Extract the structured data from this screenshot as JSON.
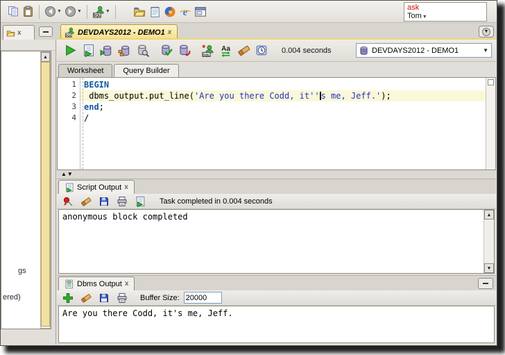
{
  "colors": {
    "active_tab": "#f6df85",
    "line_highlight": "#faf8d8",
    "keyword": "#10599c",
    "string": "#2233cc",
    "plain": "#000000",
    "search_accent": "#cc1100",
    "left_scroll_thumb": "#f2e2a2"
  },
  "top_toolbar": {
    "icons": [
      "copy-icon",
      "paste-icon",
      "back-icon",
      "forward-icon",
      "sql-worksheet-icon",
      "open-folder-icon",
      "notepad-icon",
      "firefox-icon",
      "internet-explorer-icon",
      "form-window-icon"
    ]
  },
  "search_box": {
    "line1": "ask",
    "line2": "Tom"
  },
  "tab_bar": {
    "main_tab_label": "DEVDAYS2012 - DEMO1",
    "left_tab_close": "x",
    "main_tab_close": "x"
  },
  "worksheet_toolbar": {
    "icons": [
      "run-icon",
      "run-script-icon",
      "autotrace-icon",
      "explain-plan-icon",
      "sql-tuning-advisor-icon",
      "commit-icon",
      "rollback-icon",
      "unshared-worksheet-icon",
      "case-toggle-icon",
      "clear-icon",
      "sql-history-icon"
    ],
    "elapsed_text": "0.004 seconds",
    "connection_label": "DEVDAYS2012 - DEMO1"
  },
  "editor_tabs": {
    "worksheet": "Worksheet",
    "query_builder": "Query Builder"
  },
  "editor": {
    "line_numbers": [
      "1",
      "2",
      "3",
      "4"
    ],
    "lines": [
      {
        "highlight": false,
        "segments": [
          {
            "text": "BEGIN",
            "type": "keyword"
          }
        ]
      },
      {
        "highlight": true,
        "segments": [
          {
            "text": " dbms_output.put_line(",
            "type": "plain"
          },
          {
            "text": "'Are you there Codd, it''",
            "type": "string"
          },
          {
            "text": "",
            "type": "cursor"
          },
          {
            "text": "s me, Jeff.'",
            "type": "string"
          },
          {
            "text": ");",
            "type": "plain"
          }
        ]
      },
      {
        "highlight": false,
        "segments": [
          {
            "text": "end",
            "type": "keyword"
          },
          {
            "text": ";",
            "type": "plain"
          }
        ]
      },
      {
        "highlight": false,
        "segments": [
          {
            "text": "/",
            "type": "plain"
          }
        ]
      }
    ]
  },
  "script_output": {
    "tab_label": "Script Output",
    "tab_close": "x",
    "icons": [
      "pin-icon",
      "erase-icon",
      "save-icon",
      "print-icon",
      "run-script-icon"
    ],
    "status_text": "Task completed in 0.004 seconds",
    "output_text": "anonymous block completed"
  },
  "dbms_output": {
    "tab_label": "Dbms Output",
    "tab_close": "x",
    "icons": [
      "add-output-icon",
      "erase-icon",
      "save-icon",
      "print-icon"
    ],
    "buffer_size_label": "Buffer Size:",
    "buffer_size_value": "20000",
    "output_text": "Are you there Codd, it's me, Jeff."
  },
  "left_panel": {
    "clipped_text_top": "gs",
    "clipped_text_bottom": "ered)"
  }
}
